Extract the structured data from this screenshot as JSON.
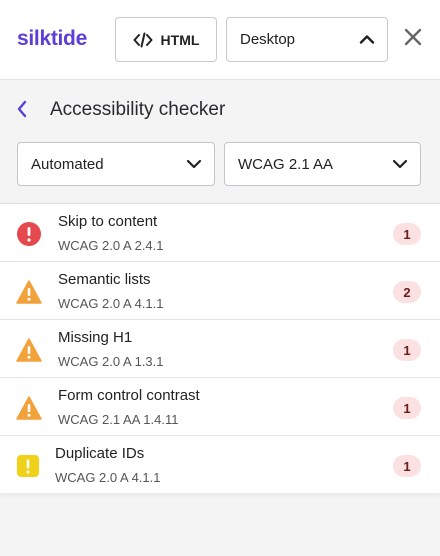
{
  "header": {
    "logo": "silktide",
    "html_button_label": "HTML",
    "view_select_value": "Desktop",
    "icons": {
      "code": "code-icon",
      "chevron": "chevron-up-icon",
      "close": "close-icon"
    }
  },
  "page": {
    "title": "Accessibility checker",
    "back_icon": "chevron-left-icon"
  },
  "filters": {
    "mode_value": "Automated",
    "standard_value": "WCAG 2.1 AA"
  },
  "colors": {
    "brand": "#5b3fd6",
    "error": "#e5484d",
    "warning": "#f2a23a",
    "notice": "#f0d21b",
    "badge_bg": "#fbe1e1"
  },
  "issues": [
    {
      "name": "Skip to content",
      "ref": "WCAG 2.0 A 2.4.1",
      "count": "1",
      "severity": "error"
    },
    {
      "name": "Semantic lists",
      "ref": "WCAG 2.0 A 4.1.1",
      "count": "2",
      "severity": "warning"
    },
    {
      "name": "Missing H1",
      "ref": "WCAG 2.0 A 1.3.1",
      "count": "1",
      "severity": "warning"
    },
    {
      "name": "Form control contrast",
      "ref": "WCAG 2.1 AA 1.4.11",
      "count": "1",
      "severity": "warning"
    },
    {
      "name": "Duplicate IDs",
      "ref": "WCAG 2.0 A 4.1.1",
      "count": "1",
      "severity": "notice"
    }
  ]
}
